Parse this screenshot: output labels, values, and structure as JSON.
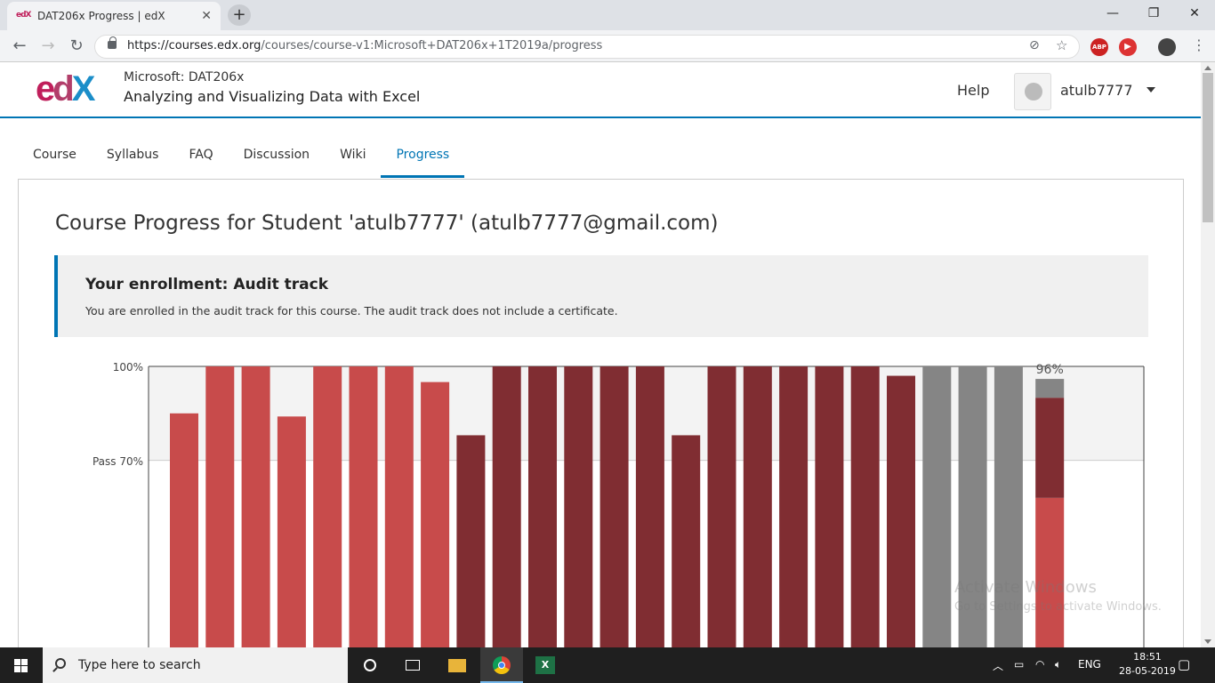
{
  "browser": {
    "tab_title": "DAT206x Progress | edX",
    "favicon": "edX",
    "url_host": "https://courses.edx.org",
    "url_path": "/courses/course-v1:Microsoft+DAT206x+1T2019a/progress",
    "ext_abp": "ABP"
  },
  "header": {
    "org": "Microsoft: DAT206x",
    "course": "Analyzing and Visualizing Data with Excel",
    "help": "Help",
    "username": "atulb7777"
  },
  "nav": {
    "tabs": [
      "Course",
      "Syllabus",
      "FAQ",
      "Discussion",
      "Wiki",
      "Progress"
    ],
    "active": "Progress"
  },
  "main": {
    "title": "Course Progress for Student 'atulb7777' (atulb7777@gmail.com)",
    "enrollment_title": "Your enrollment: Audit track",
    "enrollment_text": "You are enrolled in the audit track for this course. The audit track does not include a certificate."
  },
  "chart_data": {
    "type": "bar",
    "y_ticks": [
      "100%",
      "Pass 70%"
    ],
    "total_label": "96%",
    "colors": {
      "light": "#c84b4b",
      "dark": "#802d32",
      "gray": "#858585",
      "band": "#f3f3f3"
    },
    "bars": [
      {
        "value": 0.85,
        "color": "light"
      },
      {
        "value": 1.0,
        "color": "light"
      },
      {
        "value": 1.0,
        "color": "light"
      },
      {
        "value": 0.84,
        "color": "light"
      },
      {
        "value": 1.0,
        "color": "light"
      },
      {
        "value": 1.0,
        "color": "light"
      },
      {
        "value": 1.0,
        "color": "light"
      },
      {
        "value": 0.95,
        "color": "light"
      },
      {
        "value": 0.78,
        "color": "dark"
      },
      {
        "value": 1.0,
        "color": "dark"
      },
      {
        "value": 1.0,
        "color": "dark"
      },
      {
        "value": 1.0,
        "color": "dark"
      },
      {
        "value": 1.0,
        "color": "dark"
      },
      {
        "value": 1.0,
        "color": "dark"
      },
      {
        "value": 0.78,
        "color": "dark"
      },
      {
        "value": 1.0,
        "color": "dark"
      },
      {
        "value": 1.0,
        "color": "dark"
      },
      {
        "value": 1.0,
        "color": "dark"
      },
      {
        "value": 1.0,
        "color": "dark"
      },
      {
        "value": 1.0,
        "color": "dark"
      },
      {
        "value": 0.97,
        "color": "dark"
      },
      {
        "value": 1.0,
        "color": "gray"
      },
      {
        "value": 1.0,
        "color": "gray"
      },
      {
        "value": 1.0,
        "color": "gray"
      }
    ],
    "total_stack": [
      {
        "value": 0.58,
        "color": "light"
      },
      {
        "value": 0.32,
        "color": "dark"
      },
      {
        "value": 0.06,
        "color": "gray"
      }
    ]
  },
  "watermark": {
    "line1": "Activate Windows",
    "line2": "Go to Settings to activate Windows."
  },
  "taskbar": {
    "search_placeholder": "Type here to search",
    "lang": "ENG",
    "time": "18:51",
    "date": "28-05-2019"
  }
}
